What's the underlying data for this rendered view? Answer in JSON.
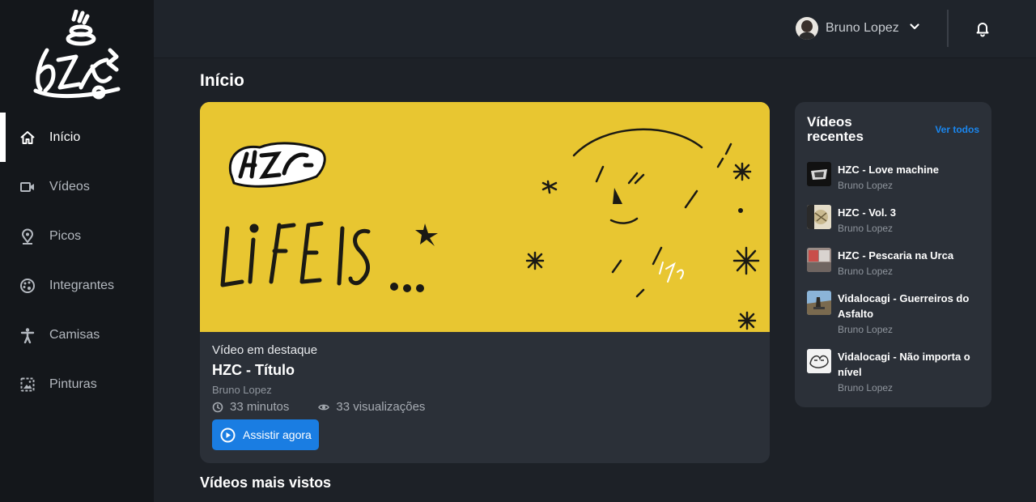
{
  "sidebar": {
    "items": [
      {
        "label": "Início",
        "icon": "home-icon",
        "active": true
      },
      {
        "label": "Vídeos",
        "icon": "video-camera-icon"
      },
      {
        "label": "Picos",
        "icon": "map-pin-icon"
      },
      {
        "label": "Integrantes",
        "icon": "palette-icon"
      },
      {
        "label": "Camisas",
        "icon": "person-icon"
      },
      {
        "label": "Pinturas",
        "icon": "image-icon"
      }
    ]
  },
  "header": {
    "user_name": "Bruno Lopez"
  },
  "main": {
    "page_title": "Início",
    "featured": {
      "kicker": "Vídeo em destaque",
      "title": "HZC - Título",
      "author": "Bruno Lopez",
      "duration": "33 minutos",
      "views": "33 visualizações",
      "button_label": "Assistir agora",
      "thumbnail_text": "LIFE IS . . ."
    },
    "most_viewed_title": "Vídeos mais vistos"
  },
  "recent": {
    "title": "Vídeos recentes",
    "see_all": "Ver todos",
    "items": [
      {
        "title": "HZC - Love machine",
        "author": "Bruno Lopez"
      },
      {
        "title": "HZC - Vol. 3",
        "author": "Bruno Lopez"
      },
      {
        "title": "HZC - Pescaria na Urca",
        "author": "Bruno Lopez"
      },
      {
        "title": "Vidalocagi - Guerreiros do Asfalto",
        "author": "Bruno Lopez"
      },
      {
        "title": "Vidalocagi - Não importa o nível",
        "author": "Bruno Lopez"
      }
    ]
  },
  "colors": {
    "background": "#1d2127",
    "sidebar": "#14171b",
    "card": "#2b3038",
    "accent": "#1a7de2",
    "thumbnail_yellow": "#e8c631"
  }
}
